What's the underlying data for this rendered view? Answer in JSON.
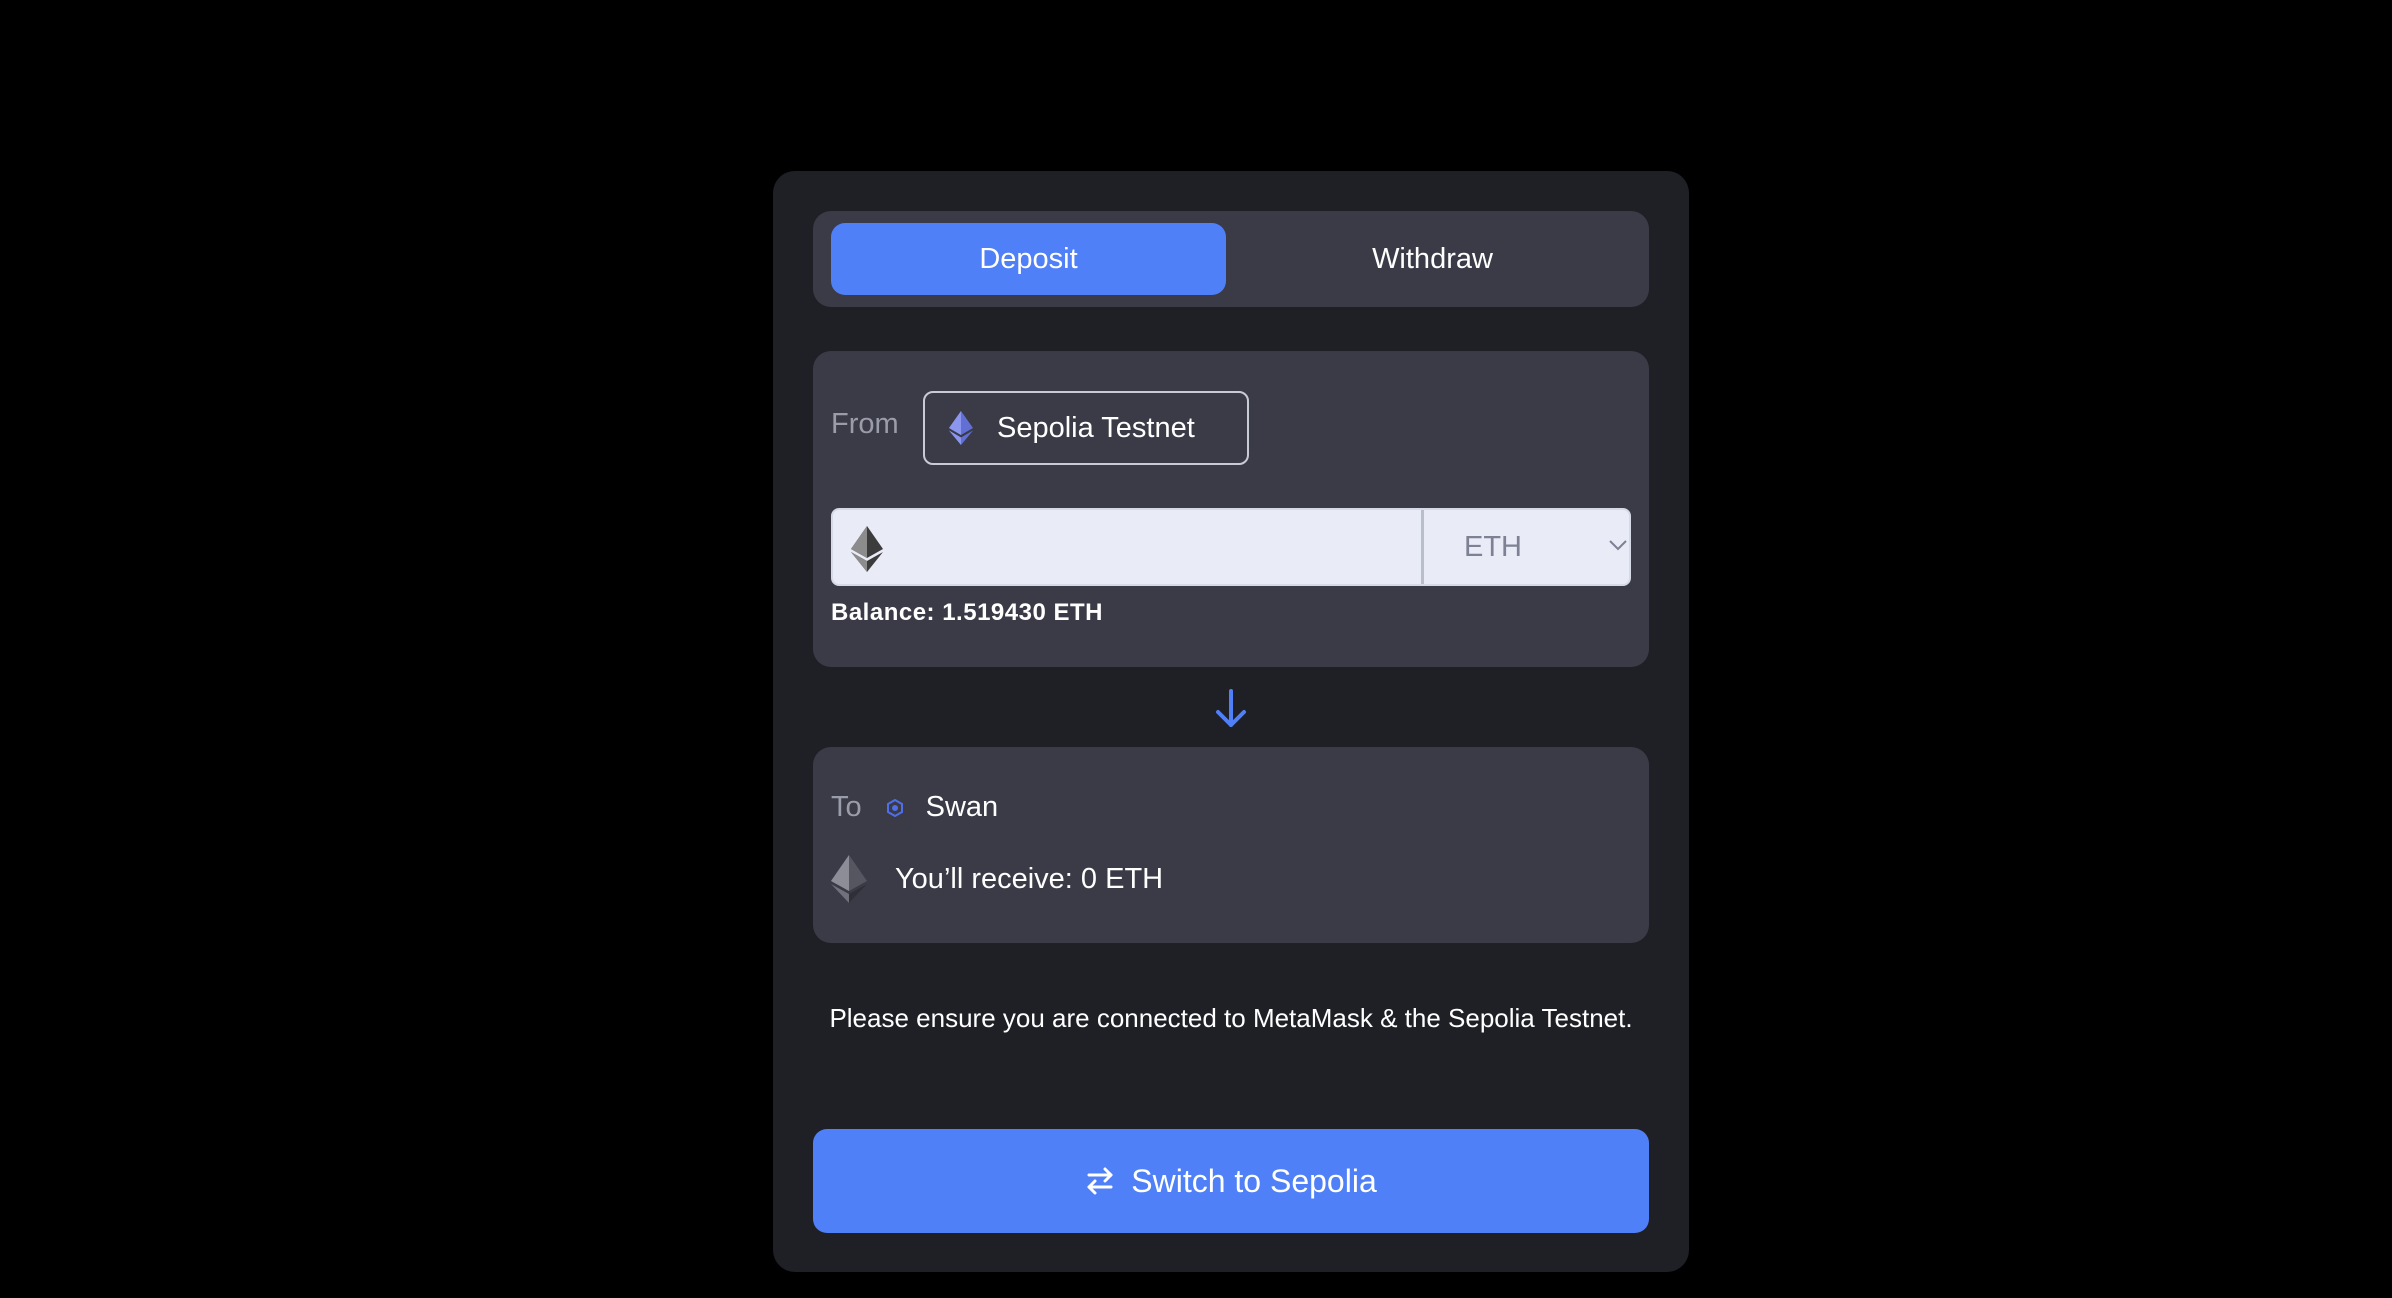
{
  "tabs": [
    {
      "label": "Deposit",
      "active": true
    },
    {
      "label": "Withdraw",
      "active": false
    }
  ],
  "from": {
    "label": "From",
    "network": {
      "label": "Sepolia Testnet",
      "icon": "ethereum-icon"
    },
    "amount": {
      "value": "",
      "icon": "ethereum-icon"
    },
    "token": {
      "selected": "ETH",
      "icon": "chevron-down-icon"
    },
    "balance": "Balance: 1.519430 ETH"
  },
  "to": {
    "label": "To",
    "network": {
      "label": "Swan",
      "icon": "swan-icon"
    },
    "receive": "You’ll receive: 0 ETH"
  },
  "notice": "Please ensure you are connected to MetaMask & the Sepolia Testnet.",
  "action": {
    "label": "Switch to Sepolia",
    "icon": "swap-icon"
  },
  "colors": {
    "accent": "#4f80f7",
    "card": "#1f2026",
    "panel": "#3a3b47",
    "background": "#000000"
  }
}
